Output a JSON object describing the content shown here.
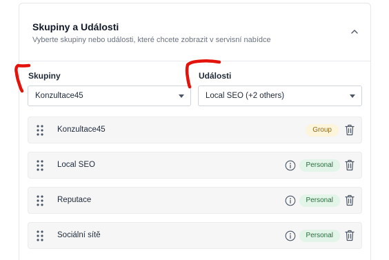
{
  "panel": {
    "title": "Skupiny a Události",
    "subtitle": "Vyberte skupiny nebo události, které chcete zobrazit v servisní nabídce"
  },
  "groups_field": {
    "label": "Skupiny",
    "value": "Konzultace45"
  },
  "events_field": {
    "label": "Události",
    "value": "Local SEO (+2 others)"
  },
  "items": [
    {
      "label": "Konzultace45",
      "badge": "Group"
    },
    {
      "label": "Local SEO",
      "badge": "Personal"
    },
    {
      "label": "Reputace",
      "badge": "Personal"
    },
    {
      "label": "Sociální sítě",
      "badge": "Personal"
    }
  ],
  "colors": {
    "annotation_red": "#e3120b",
    "badge_group_bg": "#fdf4dc",
    "badge_personal_bg": "#e3f4e8"
  },
  "icons": {
    "collapse": "chevron-up-icon",
    "drag": "drag-handle-icon",
    "info": "info-icon",
    "delete": "trash-icon",
    "dropdown": "caret-down-icon"
  }
}
